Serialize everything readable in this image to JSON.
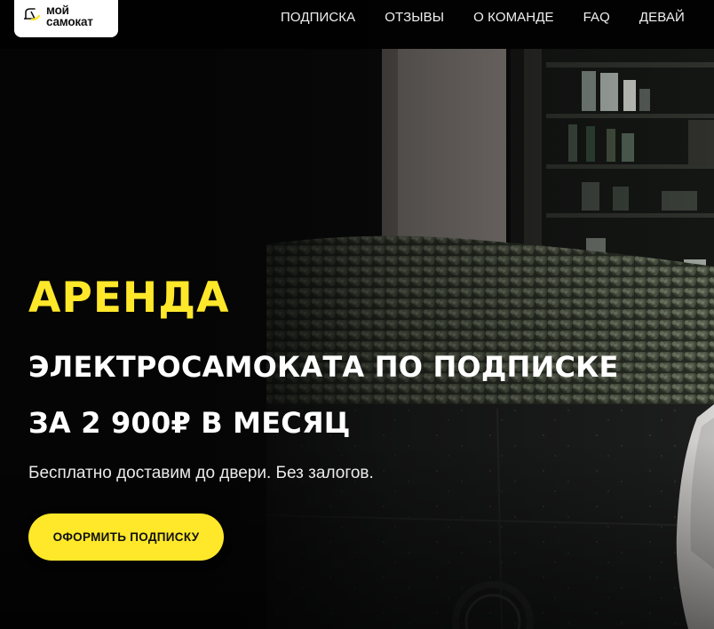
{
  "brand": {
    "logo_line1": "мой",
    "logo_line2": "самокат",
    "accent_color": "#ffe82a"
  },
  "nav": {
    "items": [
      {
        "label": "ПОДПИСКА"
      },
      {
        "label": "ОТЗЫВЫ"
      },
      {
        "label": "О КОМАНДЕ"
      },
      {
        "label": "FAQ"
      },
      {
        "label": "ДЕВАЙ"
      }
    ]
  },
  "hero": {
    "title_accent": "АРЕНДА",
    "title_line2": "ЭЛЕКТРОСАМОКАТА ПО ПОДПИСКЕ",
    "title_line3": "ЗА 2 900₽ В МЕСЯЦ",
    "subtitle": "Бесплатно доставим до двери. Без залогов.",
    "cta_label": "ОФОРМИТЬ ПОДПИСКУ"
  },
  "icons": {
    "logo": "scooter-logo-icon"
  }
}
